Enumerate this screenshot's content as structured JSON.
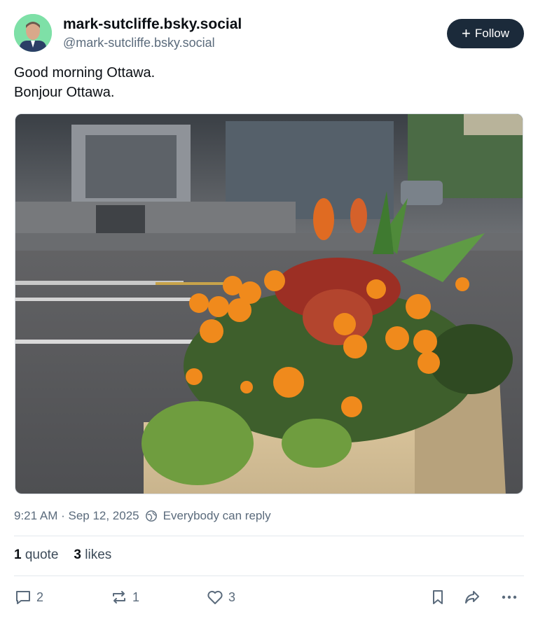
{
  "author": {
    "display_name": "mark-sutcliffe.bsky.social",
    "handle": "@mark-sutcliffe.bsky.social",
    "avatar_bg": "#7ee0a7"
  },
  "follow_button": {
    "label": "Follow",
    "icon": "plus-icon",
    "bg": "#1b2a3a"
  },
  "post": {
    "lines": [
      "Good morning Ottawa.",
      "Bonjour Ottawa."
    ],
    "image_alt": "planter-with-marigolds-photo"
  },
  "meta": {
    "timestamp": "9:21 AM · Sep 12, 2025",
    "reply_setting": "Everybody can reply",
    "reply_icon": "globe-icon"
  },
  "stats": {
    "quotes_count": "1",
    "quotes_label": "quote",
    "likes_count": "3",
    "likes_label": "likes"
  },
  "actions": {
    "reply_count": "2",
    "repost_count": "1",
    "like_count": "3",
    "icons": [
      "reply-icon",
      "repost-icon",
      "like-icon",
      "bookmark-icon",
      "share-icon",
      "more-icon"
    ]
  }
}
